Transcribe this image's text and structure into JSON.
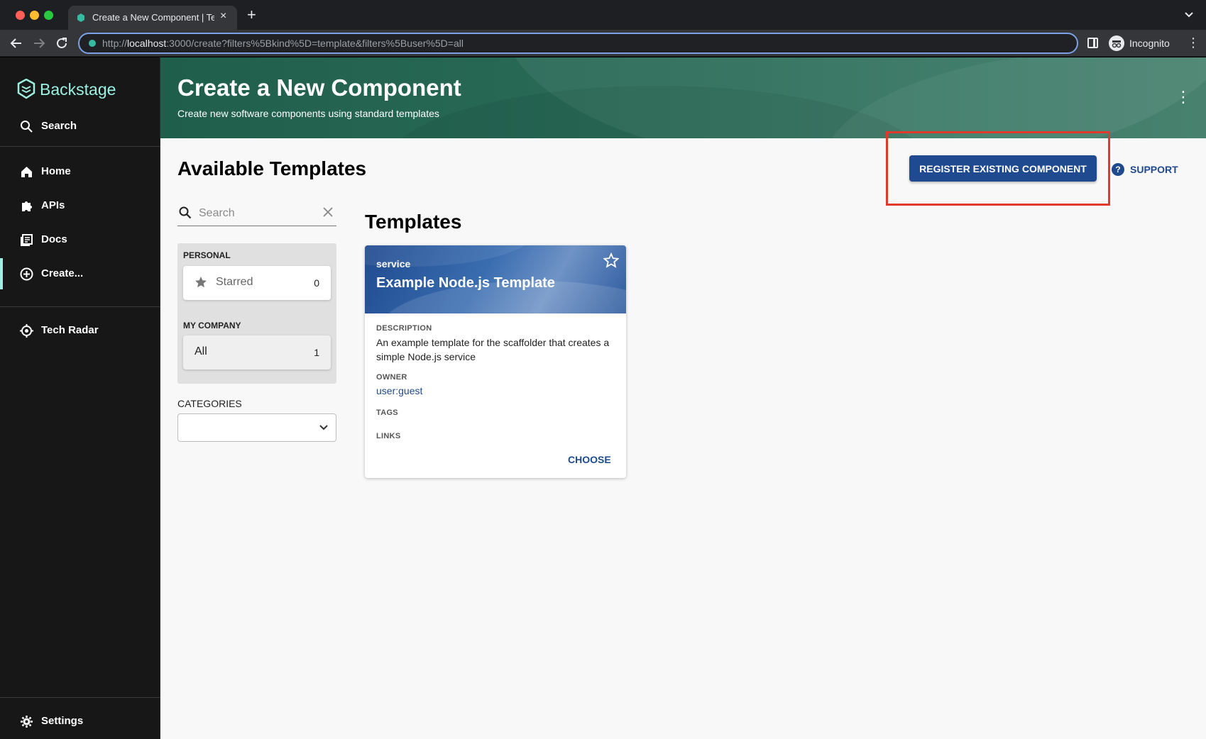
{
  "browser": {
    "tab_title": "Create a New Component | Ten",
    "url_prefix": "http://",
    "url_host": "localhost",
    "url_rest": ":3000/create?filters%5Bkind%5D=template&filters%5Buser%5D=all",
    "profile_label": "Incognito"
  },
  "sidebar": {
    "logo": "Backstage",
    "search_label": "Search",
    "items": [
      {
        "label": "Home",
        "icon": "home-icon"
      },
      {
        "label": "APIs",
        "icon": "puzzle-icon"
      },
      {
        "label": "Docs",
        "icon": "docs-icon"
      },
      {
        "label": "Create...",
        "icon": "create-icon"
      }
    ],
    "tech_radar_label": "Tech Radar",
    "settings_label": "Settings",
    "accent_color": "#9bf0e1"
  },
  "header": {
    "title": "Create a New Component",
    "subtitle": "Create new software components using standard templates"
  },
  "content": {
    "section_title": "Available Templates",
    "register_button": "REGISTER EXISTING COMPONENT",
    "support_label": "SUPPORT",
    "highlight_color": "#e03b2a"
  },
  "filters": {
    "search_placeholder": "Search",
    "personal_heading": "PERSONAL",
    "starred_label": "Starred",
    "starred_count": "0",
    "company_heading": "MY COMPANY",
    "all_label": "All",
    "all_count": "1",
    "categories_label": "CATEGORIES"
  },
  "templates": {
    "title": "Templates",
    "cards": [
      {
        "type": "service",
        "name": "Example Node.js Template",
        "description_label": "DESCRIPTION",
        "description": "An example template for the scaffolder that creates a simple Node.js service",
        "owner_label": "OWNER",
        "owner": "user:guest",
        "tags_label": "TAGS",
        "links_label": "LINKS",
        "choose_label": "CHOOSE"
      }
    ]
  }
}
